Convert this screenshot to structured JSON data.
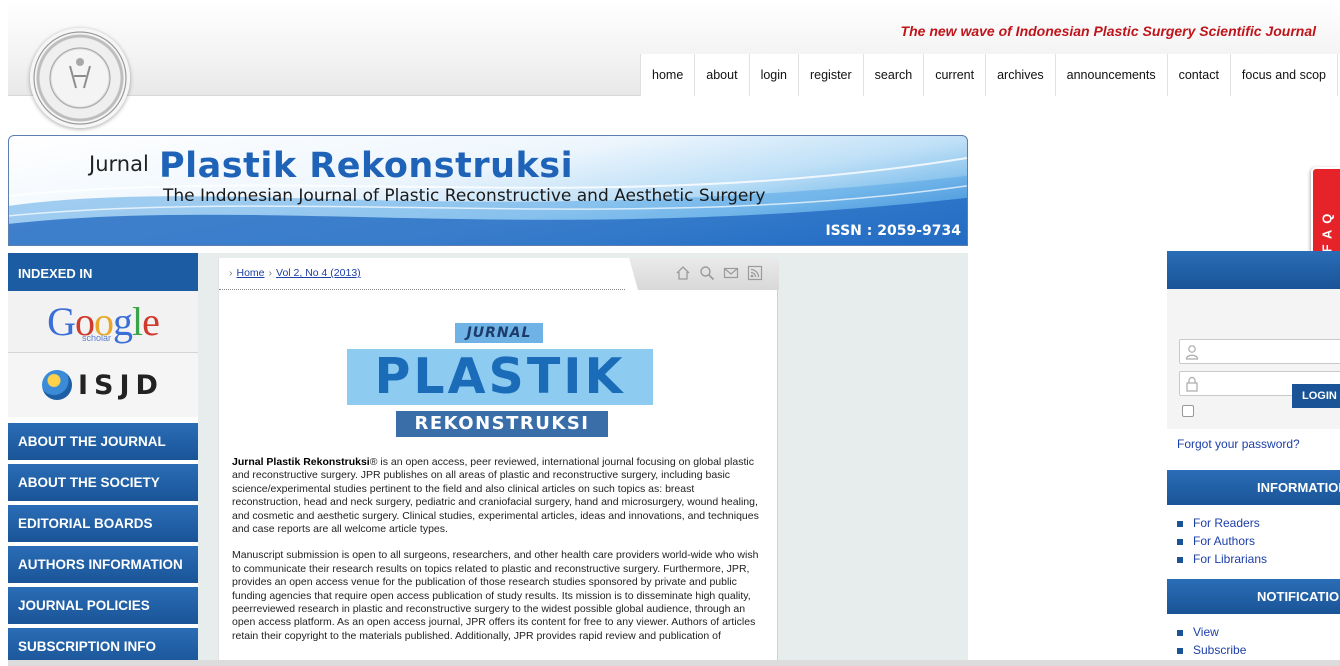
{
  "header": {
    "tagline": "The new wave of Indonesian Plastic Surgery Scientific Journal",
    "nav": [
      "home",
      "about",
      "login",
      "register",
      "search",
      "current",
      "archives",
      "announcements",
      "contact",
      "focus and scop"
    ]
  },
  "banner": {
    "jurnal": "Jurnal",
    "title": "Plastik Rekonstruksi",
    "subtitle": "The Indonesian Journal of Plastic Reconstructive and Aesthetic Surgery",
    "issn": "ISSN : 2059-9734"
  },
  "left_sidebar": {
    "indexed_title": "INDEXED IN",
    "google_word": [
      "G",
      "o",
      "o",
      "g",
      "l",
      "e"
    ],
    "google_sub": "scholar",
    "isjd": "ISJD",
    "menu": [
      "ABOUT THE JOURNAL",
      "ABOUT THE SOCIETY",
      "EDITORIAL BOARDS",
      "AUTHORS INFORMATION",
      "JOURNAL POLICIES",
      "SUBSCRIPTION INFO"
    ]
  },
  "breadcrumb": {
    "home": "Home",
    "issue": "Vol 2, No 4 (2013)"
  },
  "journal_logo": {
    "jurnal": "JURNAL",
    "plastik": "PLASTIK",
    "rekonstruksi": "REKONSTRUKSI"
  },
  "intro": {
    "name": "Jurnal Plastik Rekonstruksi",
    "p1": "® is an open access, peer reviewed, international journal focusing on global plastic and reconstructive surgery. JPR publishes on all areas of plastic and reconstructive surgery, including basic science/experimental studies pertinent to the field and also clinical articles on such topics as: breast reconstruction, head and neck surgery, pediatric and craniofacial surgery, hand and microsurgery, wound healing, and cosmetic and aesthetic surgery. Clinical studies, experimental articles, ideas and innovations, and techniques and case reports are all welcome article types.",
    "p2": "Manuscript submission is open to all surgeons, researchers, and other health care providers world-wide who wish to communicate their research results on topics related to plastic and reconstructive surgery. Furthermore, JPR, provides an open access venue for the publication of those research studies sponsored by private and public funding agencies that require open access publication of study results. Its mission is to disseminate high quality, peerreviewed research in plastic and reconstructive surgery to the widest possible global audience, through an open access platform. As an open access journal, JPR offers its content for free to any viewer. Authors of articles retain their copyright to the materials published. Additionally, JPR provides rapid review and publication of"
  },
  "faq": "FAQ",
  "right_sidebar": {
    "login_button": "LOGIN",
    "forgot": "Forgot your password?",
    "information_title": "INFORMATION",
    "information_links": [
      "For Readers",
      "For Authors",
      "For Librarians"
    ],
    "notifications_title": "NOTIFICATIONS",
    "notification_links": [
      "View",
      "Subscribe"
    ]
  }
}
